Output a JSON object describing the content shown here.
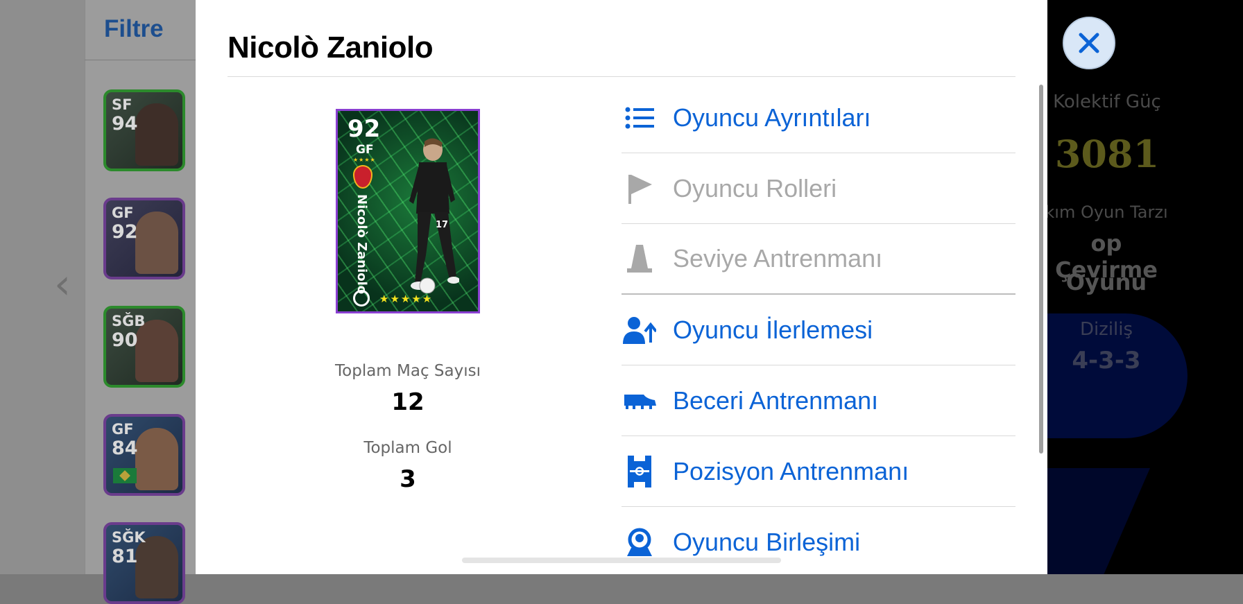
{
  "background": {
    "filter_label": "Filtre",
    "player_list": [
      {
        "position": "SF",
        "rating": "94"
      },
      {
        "position": "GF",
        "rating": "92"
      },
      {
        "position": "SĞB",
        "rating": "90"
      },
      {
        "position": "GF",
        "rating": "84"
      },
      {
        "position": "SĞK",
        "rating": "81"
      }
    ],
    "team_stats": {
      "collective_label": "Kolektif Güç",
      "collective_value": "3081",
      "playstyle_label": "kım Oyun Tarzı",
      "playstyle_value_line1": "op Çevirme",
      "playstyle_value_line2": "Oyunu",
      "formation_label": "Diziliş",
      "formation_value": "4-3-3"
    }
  },
  "modal": {
    "title": "Nicolò Zaniolo",
    "card": {
      "rating": "92",
      "position": "GF",
      "name": "Nicolò Zaniolo",
      "stars": "★★★★★"
    },
    "stats": [
      {
        "label": "Toplam Maç Sayısı",
        "value": "12"
      },
      {
        "label": "Toplam Gol",
        "value": "3"
      }
    ],
    "menu": [
      {
        "label": "Oyuncu Ayrıntıları",
        "icon": "list-icon",
        "enabled": true
      },
      {
        "label": "Oyuncu Rolleri",
        "icon": "flag-icon",
        "enabled": false
      },
      {
        "label": "Seviye Antrenmanı",
        "icon": "cone-icon",
        "enabled": false
      },
      {
        "label": "Oyuncu İlerlemesi",
        "icon": "user-progress-icon",
        "enabled": true
      },
      {
        "label": "Beceri Antrenmanı",
        "icon": "boot-icon",
        "enabled": true
      },
      {
        "label": "Pozisyon Antrenmanı",
        "icon": "pitch-icon",
        "enabled": true
      },
      {
        "label": "Oyuncu Birleşimi",
        "icon": "merge-player-icon",
        "enabled": true
      }
    ]
  },
  "colors": {
    "accent": "#0b63d6",
    "disabled": "#a8a8a8",
    "card_border": "#8a3fd1"
  }
}
